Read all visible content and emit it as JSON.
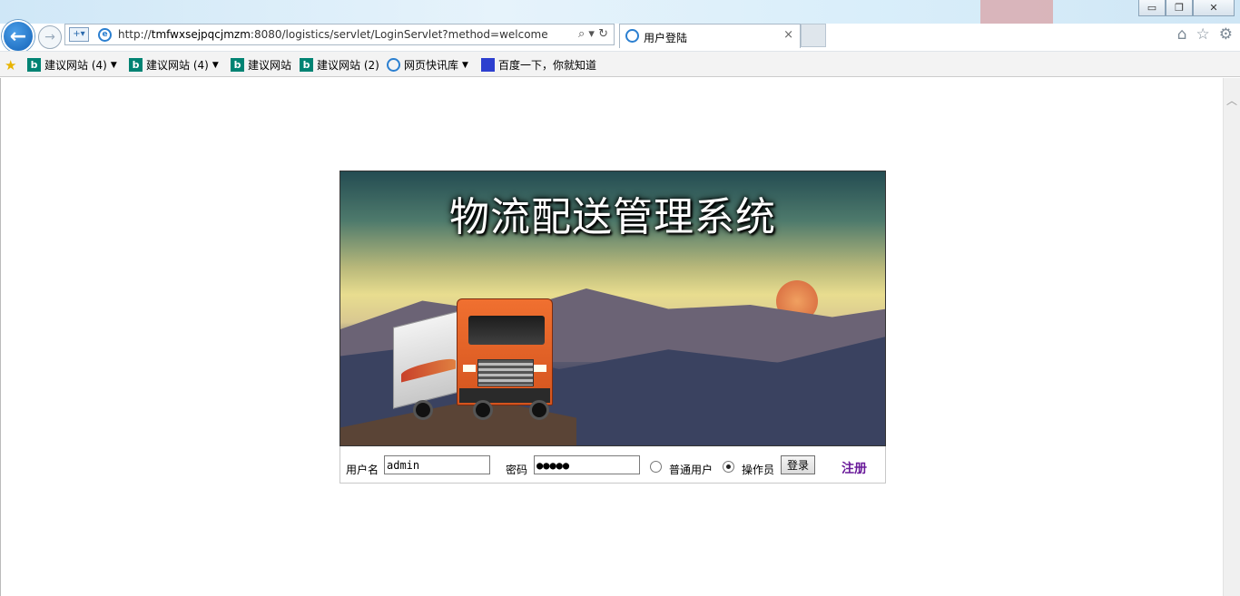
{
  "window": {
    "minimize": "▭",
    "restore": "❐",
    "close": "✕"
  },
  "addressbar": {
    "url_prefix": "http://",
    "url_host": "tmfwxsejpqcjmzm",
    "url_rest": ":8080/logistics/servlet/LoginServlet?method=welcome",
    "search_glyph": "⌕",
    "refresh_glyph": "↻"
  },
  "tab": {
    "label": "用户登陆",
    "close": "×"
  },
  "favorites": [
    {
      "label": "建议网站 (4)",
      "icon": "bing-icon",
      "dropdown": true
    },
    {
      "label": "建议网站 (4)",
      "icon": "bing-icon",
      "dropdown": true
    },
    {
      "label": "建议网站",
      "icon": "bing-icon",
      "dropdown": false
    },
    {
      "label": "建议网站 (2)",
      "icon": "bing-icon",
      "dropdown": false
    },
    {
      "label": "网页快讯库",
      "icon": "ie-icon",
      "dropdown": true
    },
    {
      "label": "百度一下，你就知道",
      "icon": "baidu-icon",
      "dropdown": false
    }
  ],
  "banner": {
    "title": "物流配送管理系统"
  },
  "login": {
    "username_label": "用户名",
    "username_value": "admin",
    "password_label": "密码",
    "password_value": "●●●●●",
    "role_normal": "普通用户",
    "role_operator": "操作员",
    "selected_role": "操作员",
    "submit": "登录",
    "register": "注册"
  },
  "colors": {
    "register_link": "#6a1b9a",
    "back_button": "#1463b8"
  }
}
